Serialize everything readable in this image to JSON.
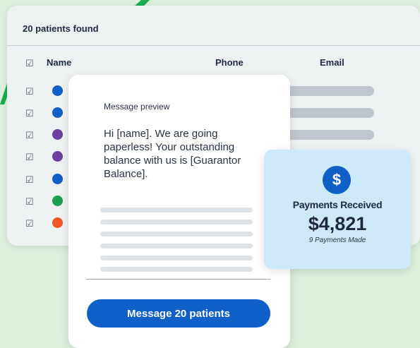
{
  "colors": {
    "background": "#ddeedd",
    "accent_green": "#16b04f",
    "primary_blue": "#0f5fc8",
    "payment_card": "#cde8f7"
  },
  "patients_table": {
    "title": "20 patients found",
    "columns": {
      "checkbox": "☑",
      "name": "Name",
      "phone": "Phone",
      "email": "Email"
    },
    "rows": [
      {
        "checkbox": "☑",
        "avatar_color": "#0f5fc8"
      },
      {
        "checkbox": "☑",
        "avatar_color": "#0f5fc8"
      },
      {
        "checkbox": "☑",
        "avatar_color": "#6b3fa0"
      },
      {
        "checkbox": "☑",
        "avatar_color": "#6b3fa0"
      },
      {
        "checkbox": "☑",
        "avatar_color": "#0f5fc8"
      },
      {
        "checkbox": "☑",
        "avatar_color": "#1aa04f"
      },
      {
        "checkbox": "☑",
        "avatar_color": "#f0562a"
      }
    ]
  },
  "message_preview": {
    "label": "Message preview",
    "body": "Hi [name]. We are going paperless! Your outstanding balance with us is [Guarantor Balance].",
    "button_label": "Message 20 patients"
  },
  "payments": {
    "icon": "dollar-icon",
    "icon_glyph": "$",
    "title": "Payments Received",
    "amount": "$4,821",
    "subtitle": "9 Payments Made"
  }
}
